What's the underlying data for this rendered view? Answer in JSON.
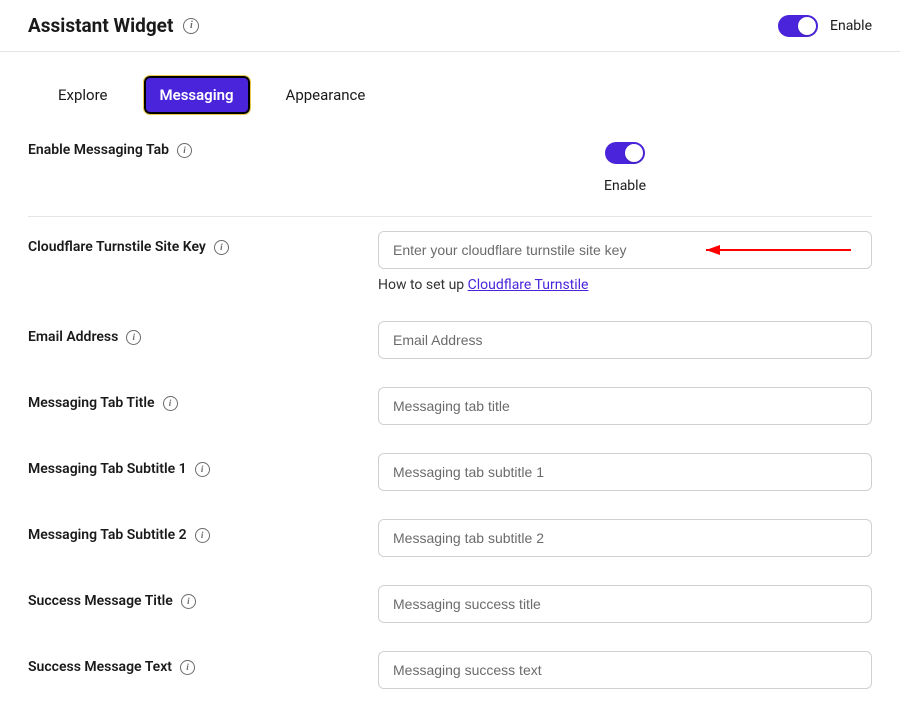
{
  "header": {
    "title": "Assistant Widget",
    "toggle_label": "Enable"
  },
  "tabs": [
    {
      "label": "Explore",
      "active": false
    },
    {
      "label": "Messaging",
      "active": true
    },
    {
      "label": "Appearance",
      "active": false
    }
  ],
  "rows": {
    "enable_tab": {
      "label": "Enable Messaging Tab",
      "toggle_label": "Enable"
    },
    "turnstile": {
      "label": "Cloudflare Turnstile Site Key",
      "placeholder": "Enter your cloudflare turnstile site key",
      "helper_prefix": "How to set up ",
      "helper_link": "Cloudflare Turnstile"
    },
    "email": {
      "label": "Email Address",
      "placeholder": "Email Address"
    },
    "tab_title": {
      "label": "Messaging Tab Title",
      "placeholder": "Messaging tab title"
    },
    "subtitle1": {
      "label": "Messaging Tab Subtitle 1",
      "placeholder": "Messaging tab subtitle 1"
    },
    "subtitle2": {
      "label": "Messaging Tab Subtitle 2",
      "placeholder": "Messaging tab subtitle 2"
    },
    "success_title": {
      "label": "Success Message Title",
      "placeholder": "Messaging success title"
    },
    "success_text": {
      "label": "Success Message Text",
      "placeholder": "Messaging success text"
    }
  }
}
